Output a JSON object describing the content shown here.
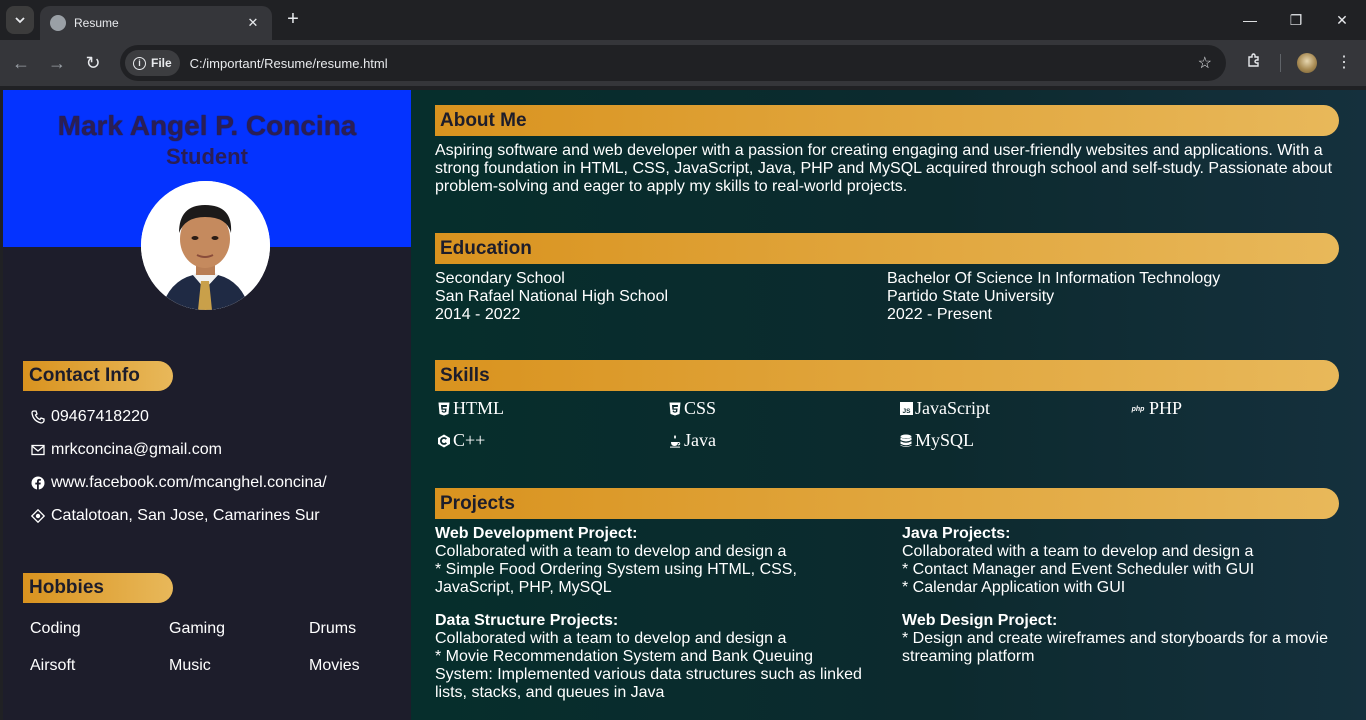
{
  "browser": {
    "tab_title": "Resume",
    "chip_label": "File",
    "url": "C:/important/Resume/resume.html"
  },
  "header": {
    "name": "Mark Angel P. Concina",
    "role": "Student"
  },
  "contact": {
    "title": "Contact Info",
    "phone": "09467418220",
    "email": "mrkconcina@gmail.com",
    "facebook": "www.facebook.com/mcanghel.concina/",
    "address": "Catalotoan, San Jose, Camarines Sur"
  },
  "hobbies": {
    "title": "Hobbies",
    "items": [
      "Coding",
      "Gaming",
      "Drums",
      "Airsoft",
      "Music",
      "Movies"
    ]
  },
  "about": {
    "title": "About Me",
    "lines": [
      "Aspiring software and web developer with a passion for creating engaging and user-friendly websites and applications. With a",
      "strong foundation in HTML, CSS, JavaScript, Java, PHP and MySQL acquired through school and self-study. Passionate about",
      "problem-solving and eager to apply my skills to real-world projects."
    ]
  },
  "education": {
    "title": "Education",
    "entries": [
      {
        "level": "Secondary School",
        "school": "San Rafael National High School",
        "years": "2014 - 2022"
      },
      {
        "level": "Bachelor Of Science In Information Technology",
        "school": "Partido State University",
        "years": "2022 - Present"
      }
    ]
  },
  "skills": {
    "title": "Skills",
    "items": [
      "HTML",
      "CSS",
      "JavaScript",
      "PHP",
      "C++",
      "Java",
      "MySQL"
    ]
  },
  "projects": {
    "title": "Projects",
    "items": [
      {
        "title": "Web Development Project:",
        "lines": [
          "Collaborated with a team to develop and design a",
          "* Simple Food Ordering System using HTML, CSS,",
          "JavaScript, PHP, MySQL"
        ]
      },
      {
        "title": "Java Projects:",
        "lines": [
          "Collaborated with a team to develop and design a",
          "* Contact Manager and Event Scheduler with GUI",
          "* Calendar Application with GUI"
        ]
      },
      {
        "title": "Data Structure Projects:",
        "lines": [
          "Collaborated with a team to develop and design a",
          "* Movie Recommendation System and Bank Queuing",
          "System: Implemented various data structures such as linked",
          "lists, stacks, and queues in Java"
        ]
      },
      {
        "title": "Web Design Project:",
        "lines": [
          "* Design and create wireframes and storyboards for a movie",
          "streaming platform"
        ]
      }
    ]
  },
  "colors": {
    "header_blue": "#0433ff",
    "sidebar_bg": "#1d1d2b",
    "accent_gold": "#d9931f",
    "main_bg": "#062e2c"
  }
}
